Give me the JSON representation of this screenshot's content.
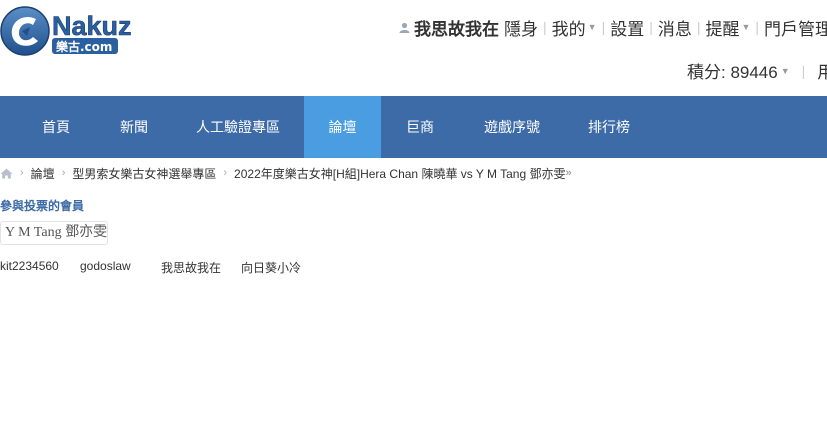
{
  "logo": {
    "brand": "Nakuz",
    "sub": "樂古.com"
  },
  "user_bar": {
    "username": "我思故我在",
    "links": [
      {
        "label": "隱身",
        "dropdown": false
      },
      {
        "label": "我的",
        "dropdown": true
      },
      {
        "label": "設置",
        "dropdown": false
      },
      {
        "label": "消息",
        "dropdown": false
      },
      {
        "label": "提醒",
        "dropdown": true
      },
      {
        "label": "門戶管理",
        "dropdown": false
      }
    ]
  },
  "credits": {
    "text": "積分: 89446",
    "next": "用"
  },
  "nav": {
    "items": [
      "首頁",
      "新聞",
      "人工驗證專區",
      "論壇",
      "巨商",
      "遊戲序號",
      "排行榜"
    ],
    "active": "論壇"
  },
  "breadcrumb": {
    "items": [
      "論壇",
      "型男索女樂古女神選舉專區",
      "2022年度樂古女神[H組]Hera Chan 陳曉華 vs Y M Tang 鄧亦雯"
    ],
    "tail": "»"
  },
  "voters_section": {
    "title": "參與投票的會員",
    "option": "Y M Tang 鄧亦雯",
    "members": [
      "kit2234560",
      "godoslaw",
      "我思故我在",
      "向日葵小冷"
    ]
  },
  "colors": {
    "nav_bg": "#3d6ba8",
    "nav_active": "#4a9de0",
    "title_blue": "#3d6ba8"
  }
}
